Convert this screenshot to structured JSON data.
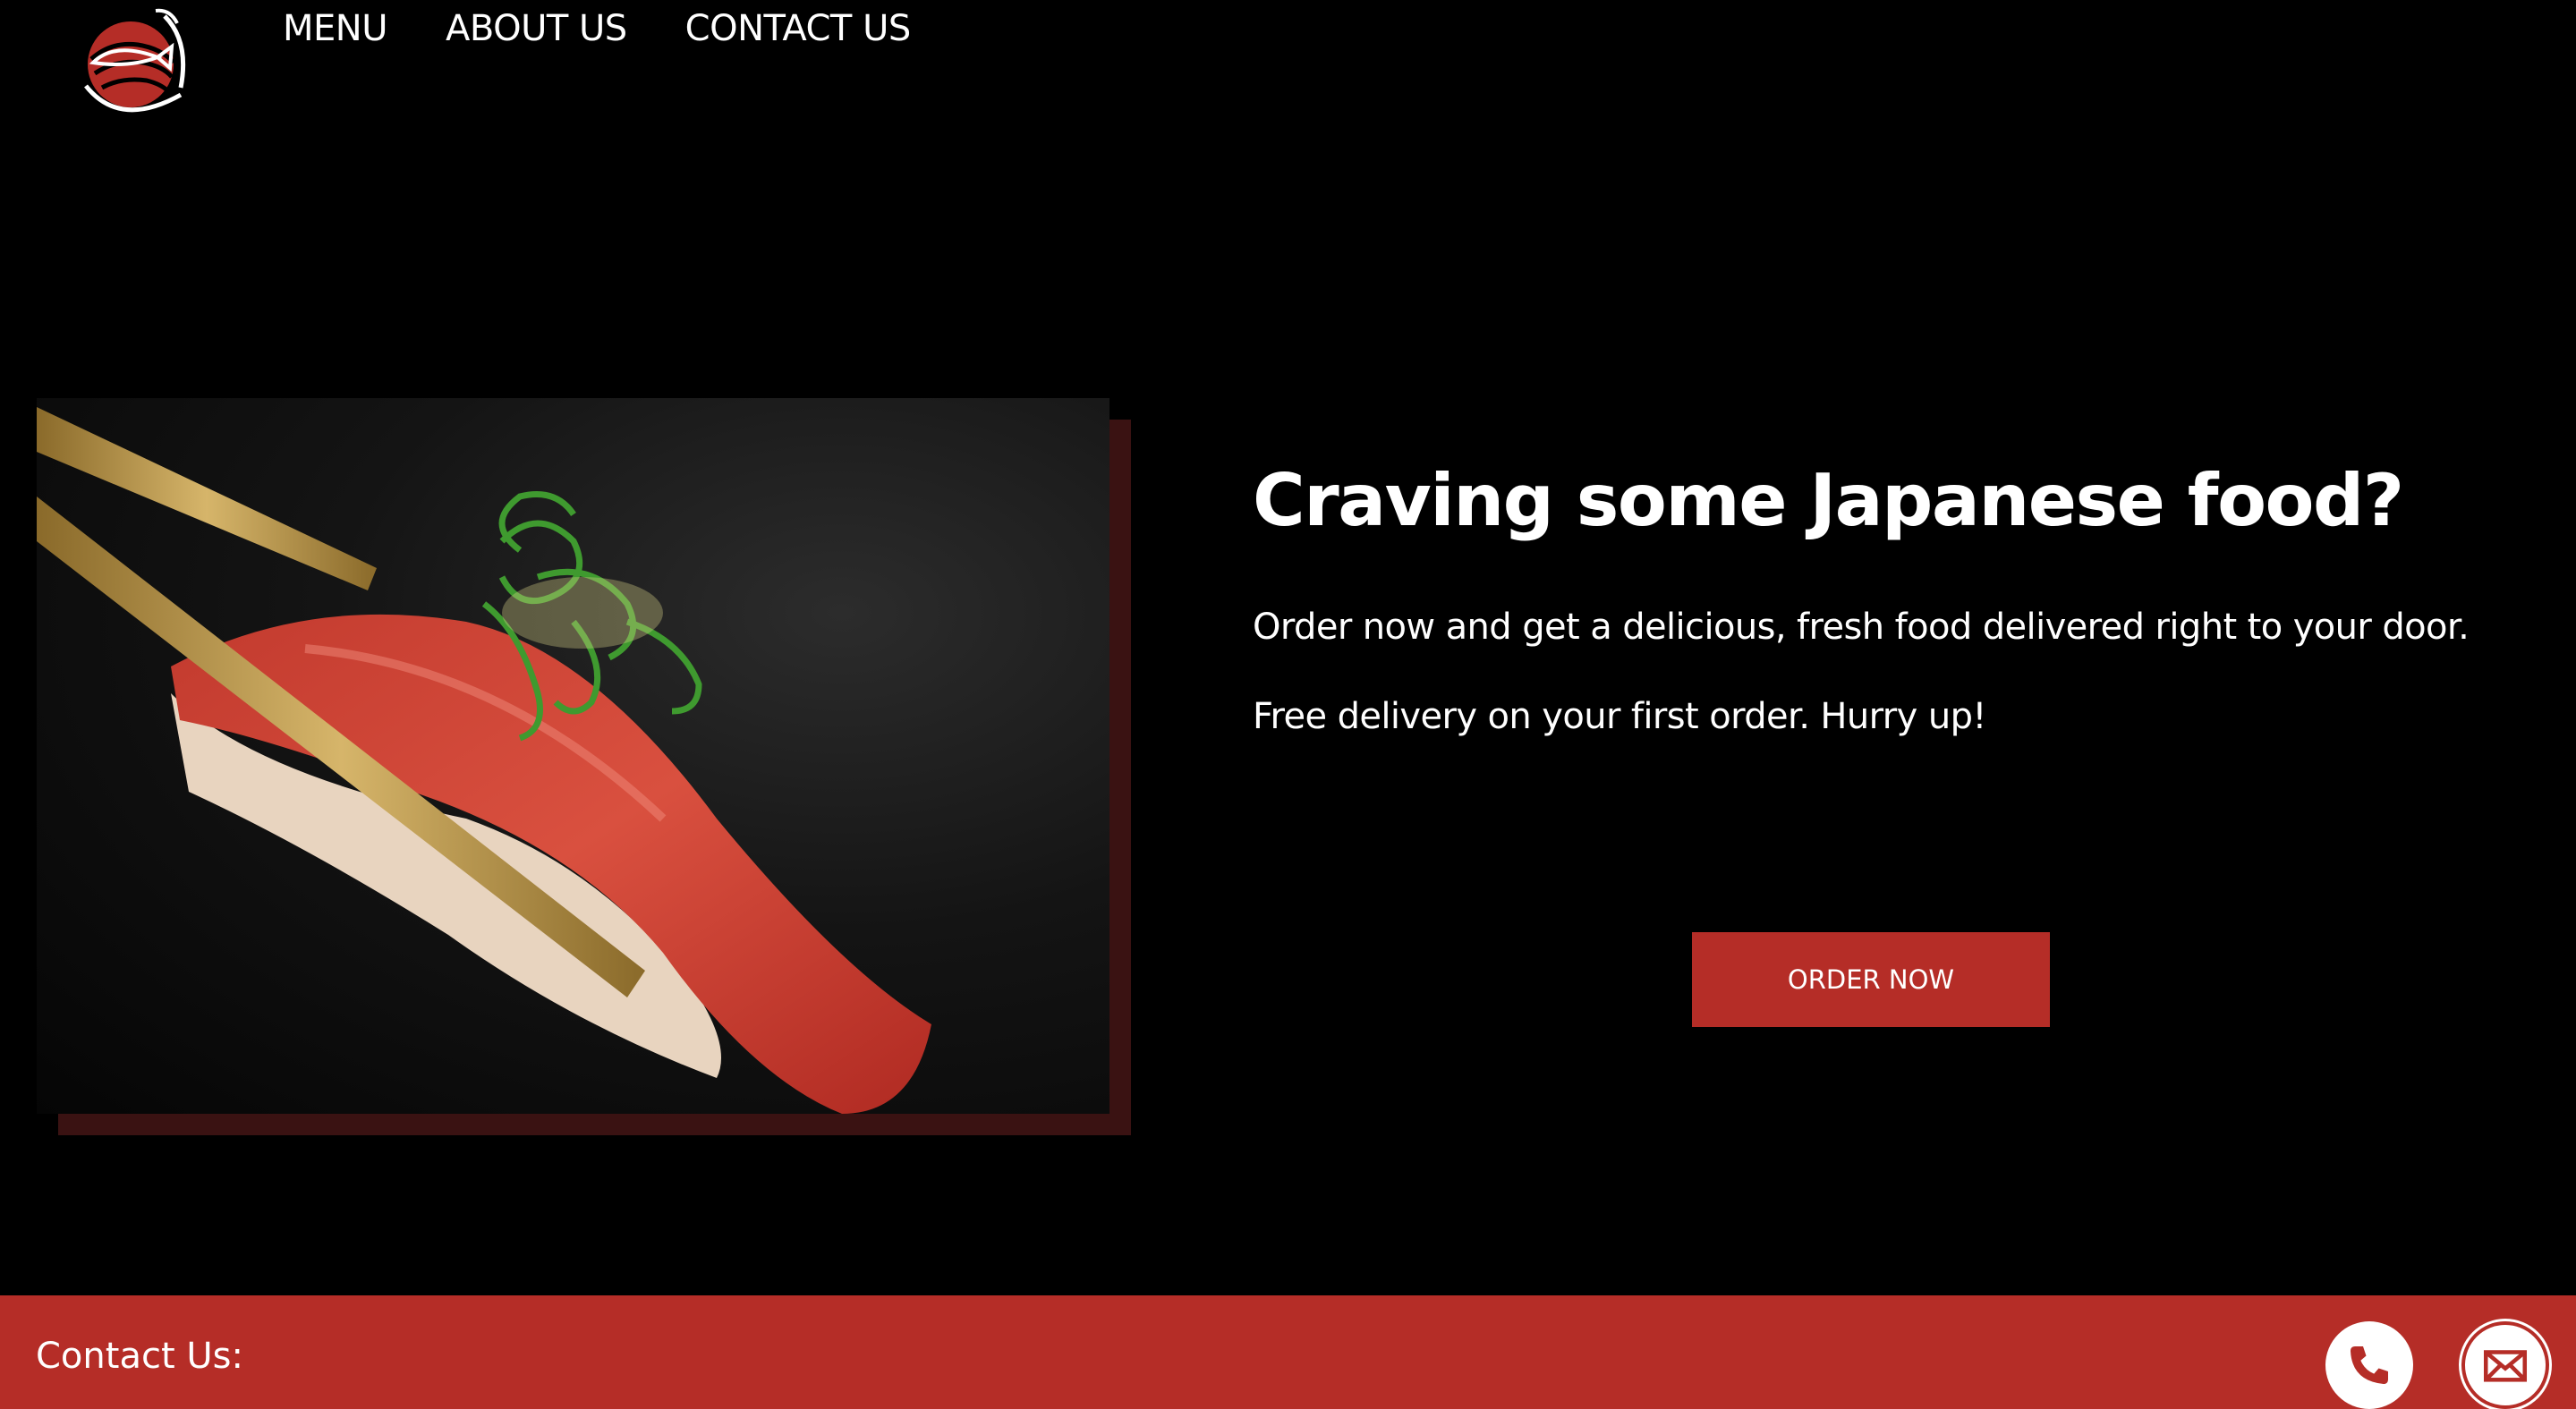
{
  "brand": {
    "logo_icon": "sushi-fish-logo",
    "accent": "#b52d27"
  },
  "nav": {
    "items": [
      {
        "label": "MENU"
      },
      {
        "label": "ABOUT US"
      },
      {
        "label": "CONTACT US"
      }
    ]
  },
  "hero": {
    "image_icon": "sushi-nigiri-photo",
    "title": "Craving some Japanese food?",
    "line1": "Order now and get a delicious, fresh food delivered right to your door.",
    "line2": "Free delivery on your first order. Hurry up!",
    "cta_label": "ORDER NOW"
  },
  "footer": {
    "label": "Contact Us:",
    "icons": [
      "phone-icon",
      "mail-icon"
    ],
    "background": "#b52d27"
  }
}
